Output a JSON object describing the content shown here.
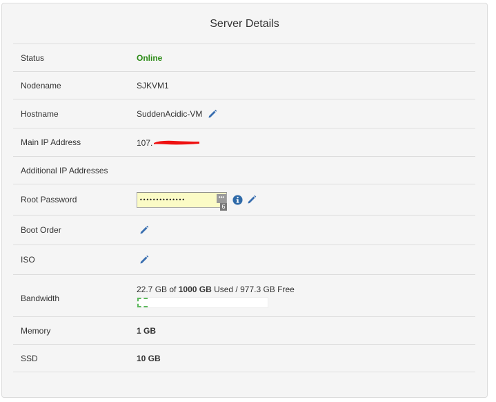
{
  "panel": {
    "title": "Server Details"
  },
  "rows": {
    "status": {
      "label": "Status",
      "value": "Online"
    },
    "nodename": {
      "label": "Nodename",
      "value": "SJKVM1"
    },
    "hostname": {
      "label": "Hostname",
      "value": "SuddenAcidic-VM"
    },
    "main_ip": {
      "label": "Main IP Address",
      "value_visible": "107."
    },
    "additional_ip": {
      "label": "Additional IP Addresses",
      "value": ""
    },
    "root_password": {
      "label": "Root Password",
      "masked_value": "••••••••••••••",
      "badge": "6",
      "toggle_glyph": "•••"
    },
    "boot_order": {
      "label": "Boot Order"
    },
    "iso": {
      "label": "ISO"
    },
    "bandwidth": {
      "label": "Bandwidth",
      "used": "22.7 GB",
      "of_text": " of ",
      "total": "1000 GB",
      "suffix": " Used / 977.3 GB Free",
      "used_fraction": 0.0227
    },
    "memory": {
      "label": "Memory",
      "value": "1 GB"
    },
    "ssd": {
      "label": "SSD",
      "value": "10 GB"
    }
  },
  "colors": {
    "online": "#2b8a16",
    "edit_icon": "#3a6fb0",
    "info_icon": "#2f6aa8",
    "redaction": "#ee1111",
    "bandwidth_fill": "#5cb85c"
  },
  "icons": {
    "edit": "pencil-icon",
    "info": "info-icon"
  }
}
